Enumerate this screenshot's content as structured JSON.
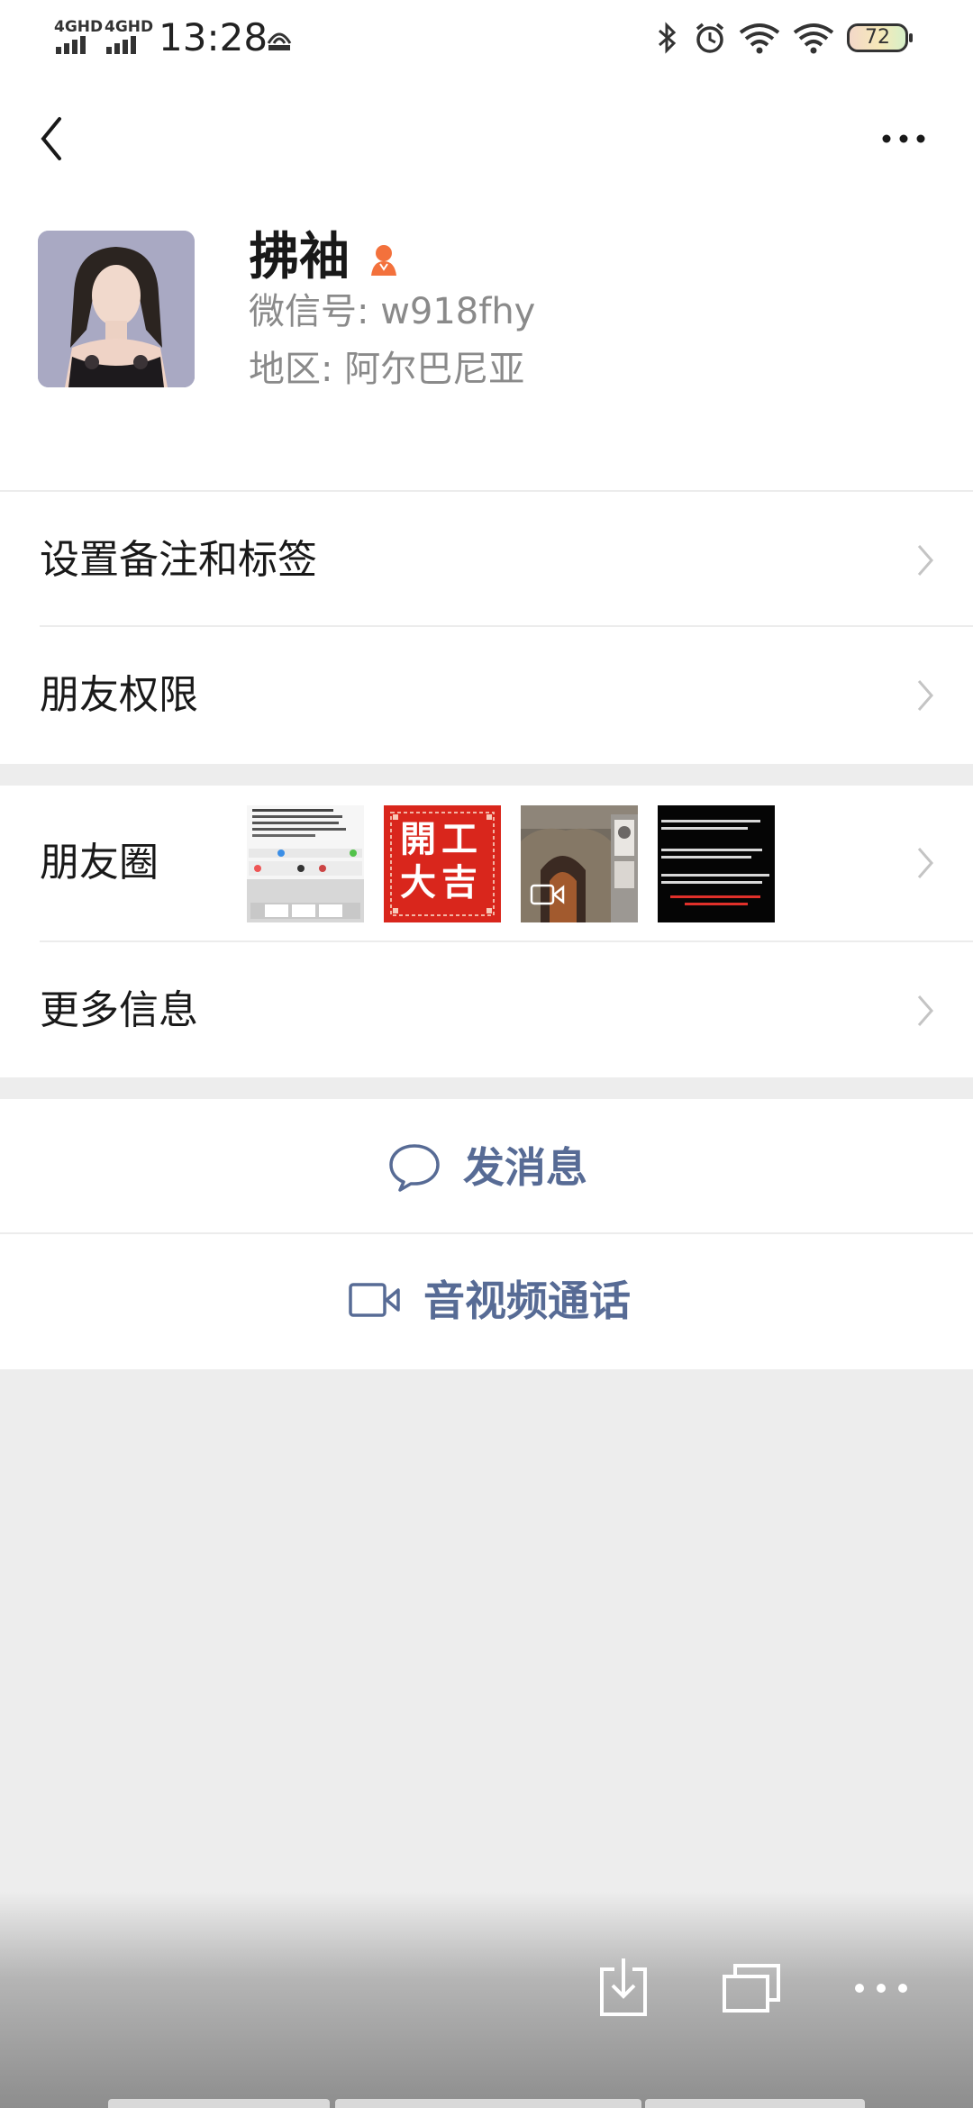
{
  "status_bar": {
    "network_1": "4GHD",
    "network_2": "4GHD",
    "time": "13:28",
    "battery": "72"
  },
  "profile": {
    "name": "拂袖",
    "wechat_id": "微信号: w918fhy",
    "region": "地区: 阿尔巴尼亚"
  },
  "rows": {
    "remarks": "设置备注和标签",
    "permissions": "朋友权限",
    "moments": "朋友圈",
    "more_info": "更多信息"
  },
  "actions": {
    "send_message": "发消息",
    "video_call": "音视频通话"
  },
  "moments_thumbs": [
    {
      "title": "screenshot"
    },
    {
      "title": "開工大吉"
    },
    {
      "title": "cave"
    },
    {
      "title": "text"
    }
  ],
  "thumb_text": {
    "red_banner": "開工大吉"
  },
  "colors": {
    "link": "#576b95",
    "gender": "#f3713c"
  }
}
